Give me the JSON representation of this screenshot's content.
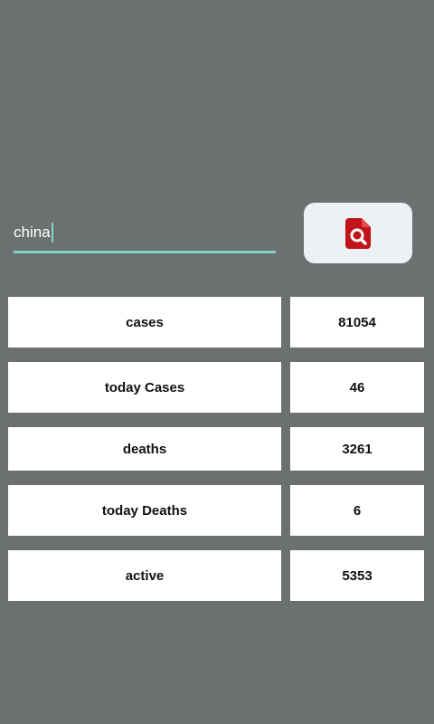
{
  "search": {
    "value": "china"
  },
  "search_button": {
    "icon": "search-file-icon",
    "icon_color": "#c1131a"
  },
  "stats": [
    {
      "label": "cases",
      "value": "81054"
    },
    {
      "label": "today Cases",
      "value": "46"
    },
    {
      "label": "deaths",
      "value": "3261"
    },
    {
      "label": "today Deaths",
      "value": "6"
    },
    {
      "label": "active",
      "value": "5353"
    }
  ],
  "colors": {
    "background": "#6d7071",
    "input_underline": "#7fd6c3",
    "button_background": "#ecf1f3",
    "cell_background": "#ffffff"
  }
}
